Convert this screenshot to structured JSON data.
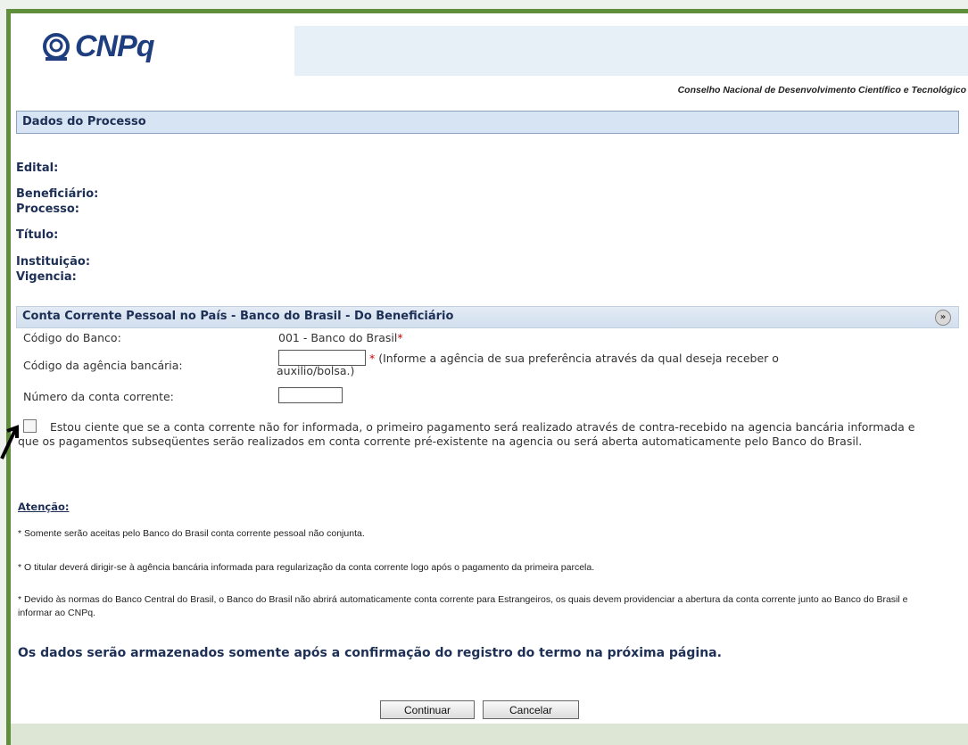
{
  "header": {
    "logo_text": "CNPq",
    "subtitle": "Conselho Nacional de Desenvolvimento Científico e Tecnológico"
  },
  "process": {
    "section_title": "Dados do Processo",
    "fields": {
      "edital": "Edital:",
      "beneficiario": "Beneficiário:",
      "processo": "Processo:",
      "titulo": "Título:",
      "instituicao": "Instituição:",
      "vigencia": "Vigencia:"
    }
  },
  "account": {
    "section_title": "Conta Corrente Pessoal no País - Banco do Brasil - Do Beneficiário",
    "bank_code_label": "Código do Banco:",
    "bank_code_value": "001 - Banco do Brasil",
    "required_mark": "*",
    "agency_label": "Código da agência bancária:",
    "agency_value": "",
    "agency_hint_line1": " (Informe a agência de sua preferência através da qual deseja receber o",
    "agency_hint_line2": "auxilio/bolsa.)",
    "account_label": "Número da conta corrente:",
    "account_value": "",
    "declaration": "Estou ciente que se a conta corrente não for informada, o primeiro pagamento será realizado através de contra-recebido na agencia bancária informada e que os pagamentos subseqüentes serão realizados em conta corrente pré-existente na agencia ou será aberta automaticamente pelo Banco do Brasil.",
    "declaration_checked": false
  },
  "notes": {
    "title": "Atenção:",
    "items": [
      "* Somente serão aceitas pelo Banco do Brasil conta corrente pessoal não conjunta.",
      "* O titular deverá dirigir-se à agência bancária informada para regularização da conta corrente logo após o pagamento da primeira parcela.",
      "* Devido às normas do Banco Central do Brasil, o Banco do Brasil não abrirá automaticamente conta corrente para Estrangeiros, os quais devem providenciar a abertura da conta corrente junto ao Banco do Brasil e informar ao CNPq."
    ]
  },
  "final_message": "Os dados serão armazenados somente após a confirmação do registro do termo na próxima página.",
  "buttons": {
    "continue": "Continuar",
    "cancel": "Cancelar"
  },
  "colors": {
    "frame_border": "#5f8f3a",
    "section_bar": "#d7e4f3",
    "label_text": "#1d2f55",
    "required": "#cc0000"
  }
}
